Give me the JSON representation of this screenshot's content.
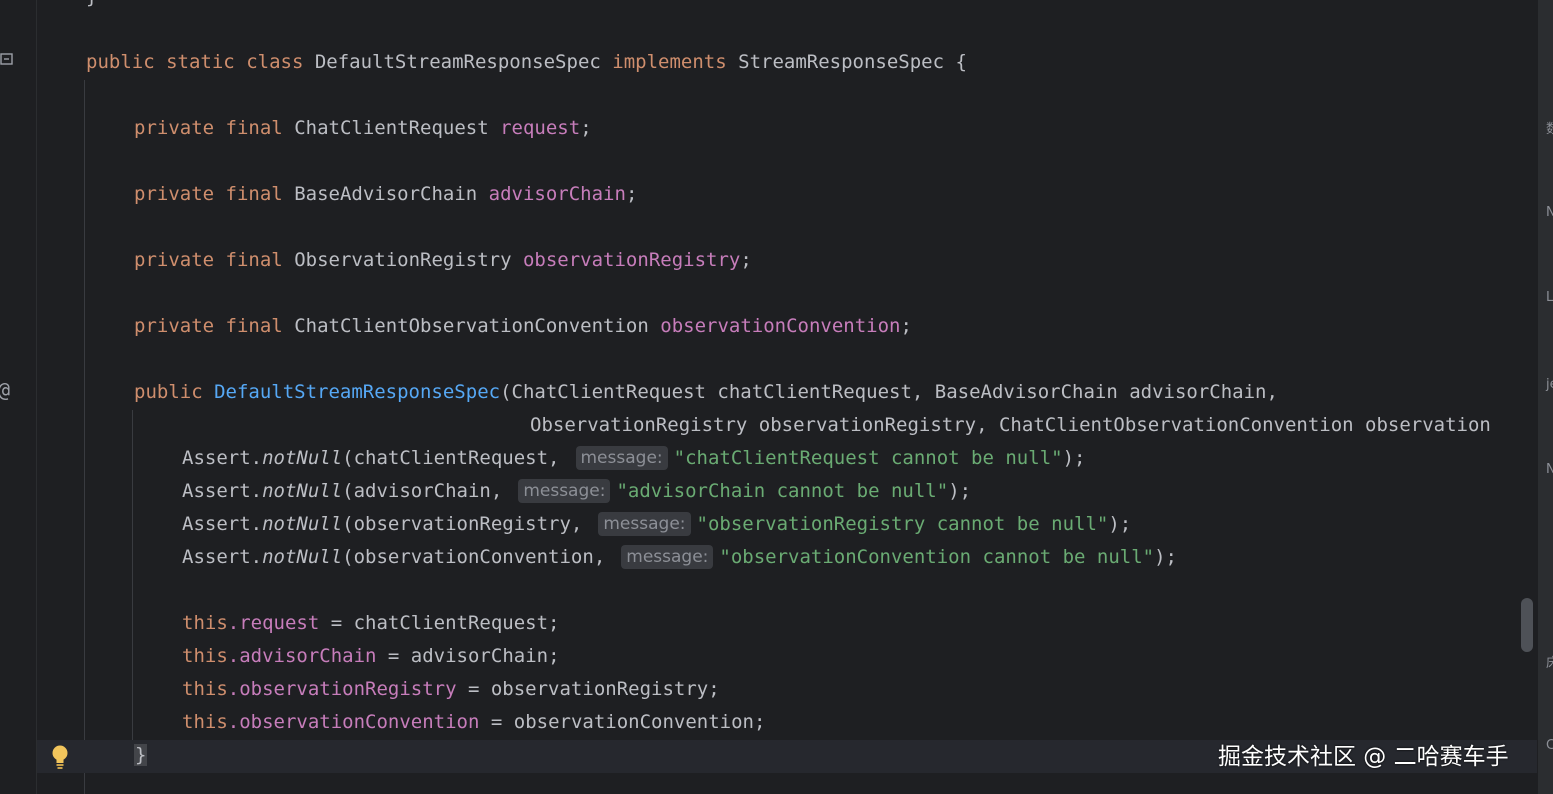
{
  "gutter": {
    "fold_icon": "fold-collapse-icon",
    "annotation_icon": "at-sign-icon",
    "at_glyph": "@",
    "bulb_icon": "lightbulb-icon"
  },
  "code": {
    "class_decl": {
      "public": "public",
      "static": "static",
      "class": "class",
      "name": "DefaultStreamResponseSpec",
      "implements": "implements",
      "iface": "StreamResponseSpec",
      "brace": "{"
    },
    "fields": [
      {
        "private": "private",
        "final": "final",
        "type": "ChatClientRequest",
        "name": "request",
        "semi": ";"
      },
      {
        "private": "private",
        "final": "final",
        "type": "BaseAdvisorChain",
        "name": "advisorChain",
        "semi": ";"
      },
      {
        "private": "private",
        "final": "final",
        "type": "ObservationRegistry",
        "name": "observationRegistry",
        "semi": ";"
      },
      {
        "private": "private",
        "final": "final",
        "type": "ChatClientObservationConvention",
        "name": "observationConvention",
        "semi": ";"
      }
    ],
    "ctor": {
      "public": "public",
      "name": "DefaultStreamResponseSpec",
      "params1": "(ChatClientRequest chatClientRequest, BaseAdvisorChain advisorChain,",
      "params2": "ObservationRegistry observationRegistry, ChatClientObservationConvention observation"
    },
    "asserts": [
      {
        "cls": "Assert.",
        "method": "notNull",
        "arg": "(chatClientRequest,",
        "hint": "message:",
        "str": "\"chatClientRequest cannot be null\"",
        "end": ");"
      },
      {
        "cls": "Assert.",
        "method": "notNull",
        "arg": "(advisorChain,",
        "hint": "message:",
        "str": "\"advisorChain cannot be null\"",
        "end": ");"
      },
      {
        "cls": "Assert.",
        "method": "notNull",
        "arg": "(observationRegistry,",
        "hint": "message:",
        "str": "\"observationRegistry cannot be null\"",
        "end": ");"
      },
      {
        "cls": "Assert.",
        "method": "notNull",
        "arg": "(observationConvention,",
        "hint": "message:",
        "str": "\"observationConvention cannot be null\"",
        "end": ");"
      }
    ],
    "assigns": [
      {
        "this": "this",
        "field": ".request",
        "rest": " = chatClientRequest;"
      },
      {
        "this": "this",
        "field": ".advisorChain",
        "rest": " = advisorChain;"
      },
      {
        "this": "this",
        "field": ".observationRegistry",
        "rest": " = observationRegistry;"
      },
      {
        "this": "this",
        "field": ".observationConvention",
        "rest": " = observationConvention;"
      }
    ],
    "close_brace": "}",
    "top_brace": "}"
  },
  "watermark": "掘金技术社区 @ 二哈赛车手",
  "side_glyphs": [
    "数",
    "N",
    "L",
    "je",
    "N",
    "床",
    "C"
  ],
  "colors": {
    "background": "#1e1f22",
    "keyword": "#cf8e6d",
    "field": "#c77dbb",
    "function": "#56a8f5",
    "string": "#6aab73",
    "text": "#bcbec4"
  }
}
